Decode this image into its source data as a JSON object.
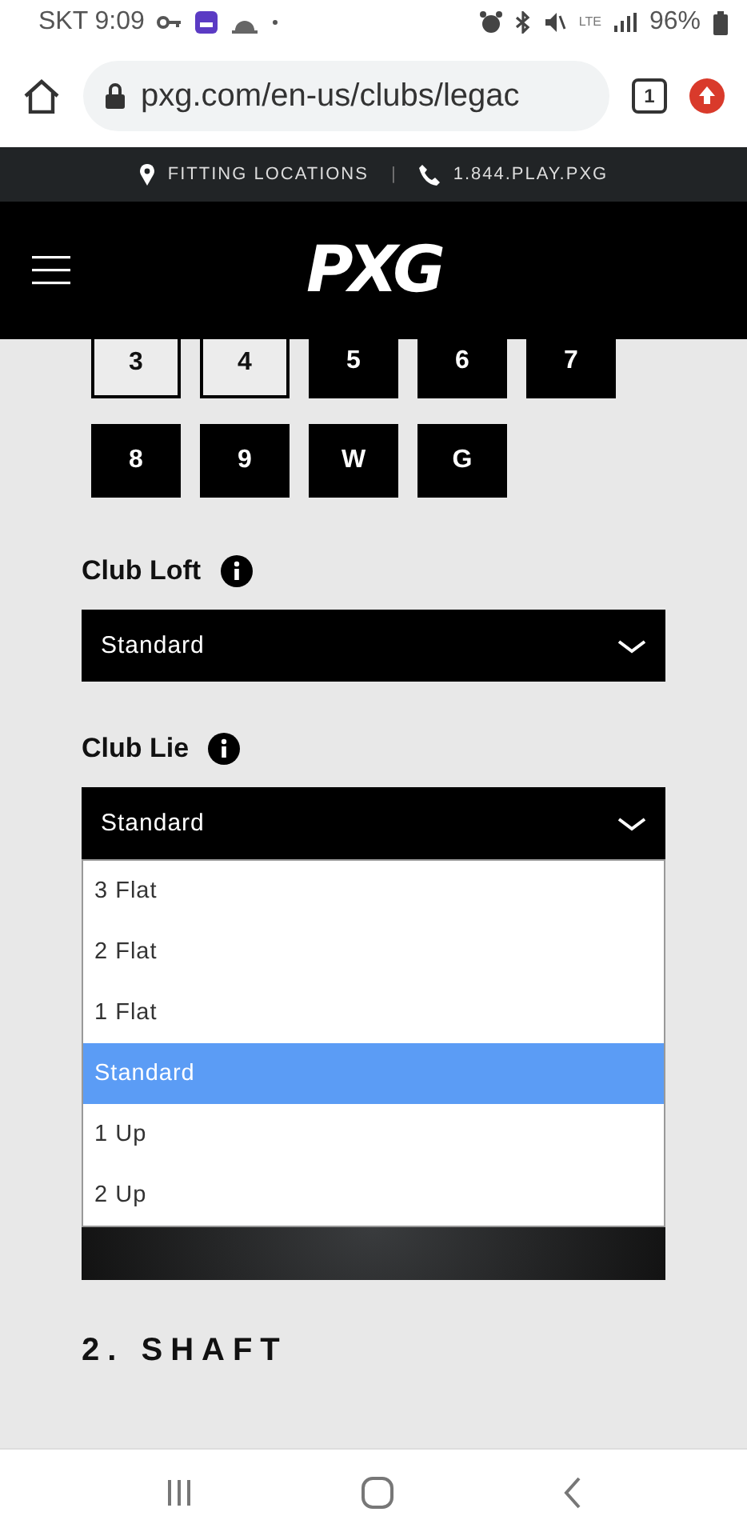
{
  "status_bar": {
    "carrier_time": "SKT 9:09",
    "network": "LTE",
    "battery": "96%"
  },
  "browser": {
    "url": "pxg.com/en-us/clubs/legac",
    "tab_count": "1"
  },
  "top_bar": {
    "fitting": "FITTING LOCATIONS",
    "separator": "|",
    "phone": "1.844.PLAY.PXG"
  },
  "header": {
    "logo": "PXG"
  },
  "club_buttons": [
    {
      "label": "3",
      "selected": false
    },
    {
      "label": "4",
      "selected": false
    },
    {
      "label": "5",
      "selected": true
    },
    {
      "label": "6",
      "selected": true
    },
    {
      "label": "7",
      "selected": true
    },
    {
      "label": "8",
      "selected": true
    },
    {
      "label": "9",
      "selected": true
    },
    {
      "label": "W",
      "selected": true
    },
    {
      "label": "G",
      "selected": true
    }
  ],
  "club_loft": {
    "label": "Club Loft",
    "value": "Standard"
  },
  "club_lie": {
    "label": "Club Lie",
    "value": "Standard",
    "expanded": true,
    "options": [
      {
        "label": "3 Flat",
        "selected": false
      },
      {
        "label": "2 Flat",
        "selected": false
      },
      {
        "label": "1 Flat",
        "selected": false
      },
      {
        "label": "Standard",
        "selected": true
      },
      {
        "label": "1 Up",
        "selected": false
      },
      {
        "label": "2 Up",
        "selected": false
      }
    ]
  },
  "section_heading": "2. SHAFT"
}
